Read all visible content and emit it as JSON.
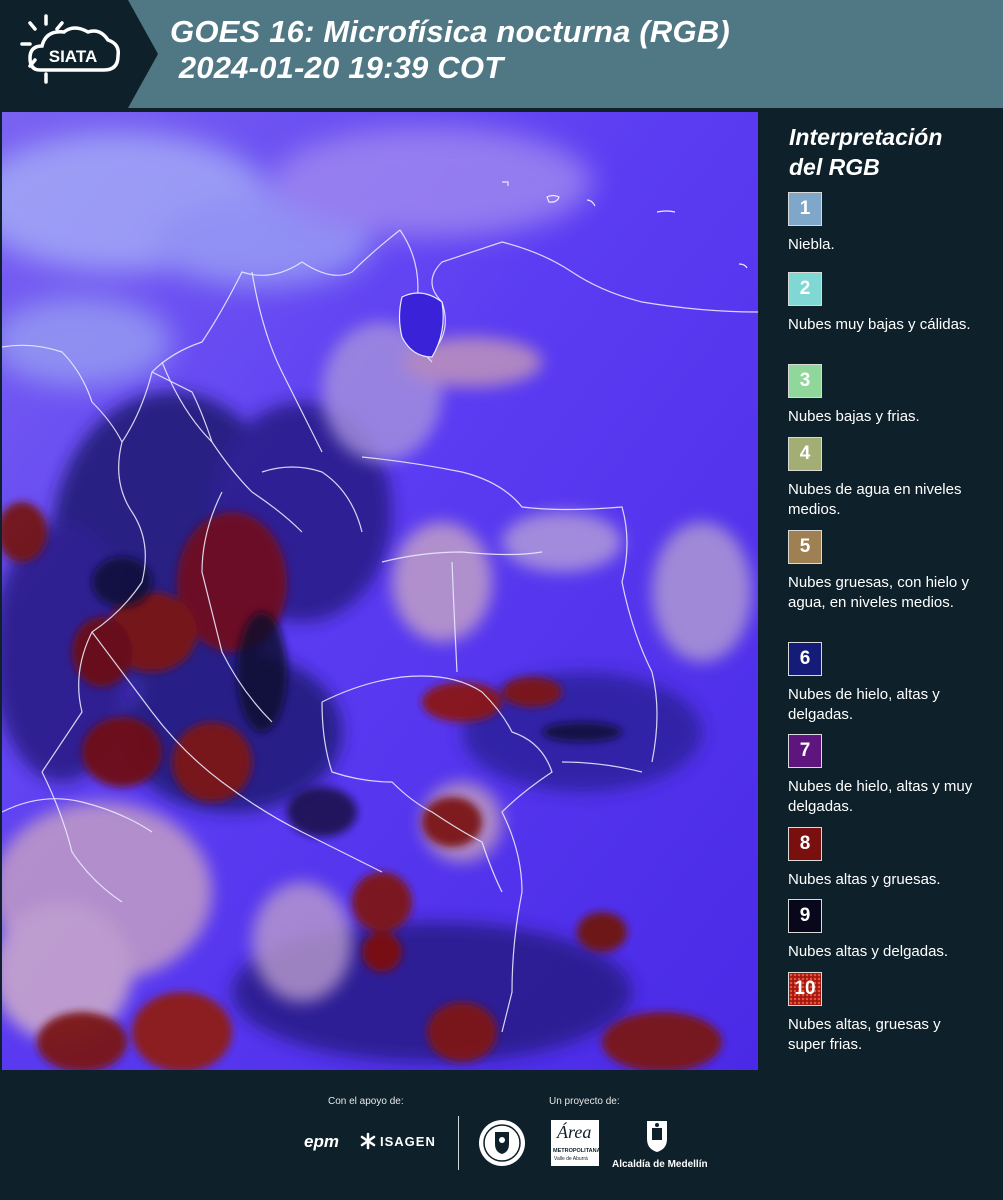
{
  "header": {
    "logo_text": "SIATA",
    "title_line1": "GOES 16: Microfísica nocturna (RGB)",
    "title_line2": " 2024-01-20 19:39 COT",
    "background": "#4f7784"
  },
  "legend": {
    "title_line1": "Interpretación",
    "title_line2": "del RGB",
    "items": [
      {
        "num": "1",
        "color": "#7fa7c9",
        "text": "Niebla."
      },
      {
        "num": "2",
        "color": "#7fd8d4",
        "text": "Nubes muy bajas y cálidas."
      },
      {
        "num": "3",
        "color": "#8fd79a",
        "text": "Nubes bajas y frias."
      },
      {
        "num": "4",
        "color": "#a3ae75",
        "text": "Nubes de agua en niveles medios."
      },
      {
        "num": "5",
        "color": "#9e8053",
        "text": "Nubes gruesas, con hielo y agua, en niveles medios."
      },
      {
        "num": "6",
        "color": "#141c78",
        "text": "Nubes de hielo, altas y delgadas."
      },
      {
        "num": "7",
        "color": "#5e157d",
        "text": "Nubes de hielo, altas y muy delgadas."
      },
      {
        "num": "8",
        "color": "#7a0f0f",
        "text": "Nubes altas y gruesas."
      },
      {
        "num": "9",
        "color": "#08071c",
        "text": "Nubes altas y delgadas."
      },
      {
        "num": "10",
        "color": "#a6150f",
        "text": "Nubes altas, gruesas y super frias."
      }
    ]
  },
  "footer": {
    "support_label": "Con el apoyo de:",
    "project_label": "Un proyecto de:",
    "sponsor_epm": "epm",
    "sponsor_isagen": "ISAGEN",
    "partner_area": "Área",
    "partner_area_sub": "METROPOLITANA",
    "partner_area_sub2": "Valle de Aburrá",
    "partner_alcaldia": "Alcaldía de Medellín"
  }
}
